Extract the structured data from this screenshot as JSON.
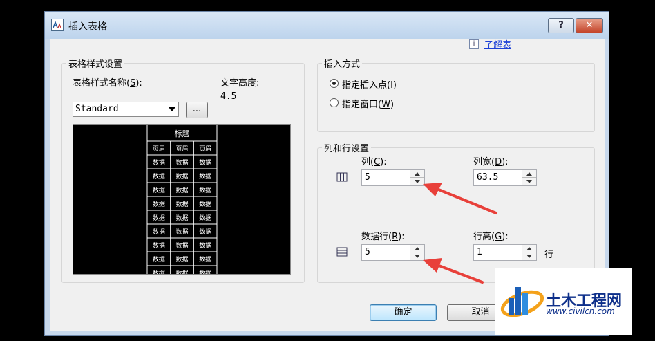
{
  "dialog": {
    "title": "插入表格",
    "help_label": "?",
    "close_label": "✕",
    "learn_more": "了解表",
    "info_glyph": "i"
  },
  "style_group": {
    "title": "表格样式设置",
    "name_label": "表格样式名称(",
    "name_key": "S",
    "name_suffix": "):",
    "style_value": "Standard",
    "browse_label": "...",
    "text_height_label": "文字高度:",
    "text_height_value": "4.5"
  },
  "preview": {
    "title": "标题",
    "header_cells": [
      "页眉",
      "页眉",
      "页眉"
    ],
    "data_cell": "数据",
    "data_rows": 9,
    "colors": {
      "background": "#000000",
      "lines": "#ffffff"
    }
  },
  "insert_group": {
    "title": "插入方式",
    "options": [
      {
        "label": "指定插入点(",
        "key": "I",
        "suffix": ")",
        "selected": true
      },
      {
        "label": "指定窗口(",
        "key": "W",
        "suffix": ")",
        "selected": false
      }
    ]
  },
  "colrow_group": {
    "title": "列和行设置",
    "columns_label": "列(",
    "columns_key": "C",
    "columns_suffix": "):",
    "columns_value": "5",
    "col_width_label": "列宽(",
    "col_width_key": "D",
    "col_width_suffix": "):",
    "col_width_value": "63.5",
    "rows_label": "数据行(",
    "rows_key": "R",
    "rows_suffix": "):",
    "rows_value": "5",
    "row_height_label": "行高(",
    "row_height_key": "G",
    "row_height_suffix": "):",
    "row_height_value": "1",
    "row_unit": "行"
  },
  "buttons": {
    "ok": "确定",
    "cancel": "取消"
  },
  "watermark": {
    "name": "土木工程网",
    "url": "www.civilcn.com"
  },
  "colors": {
    "accent_arrow": "#e8403a",
    "link": "#1b3fd6"
  }
}
